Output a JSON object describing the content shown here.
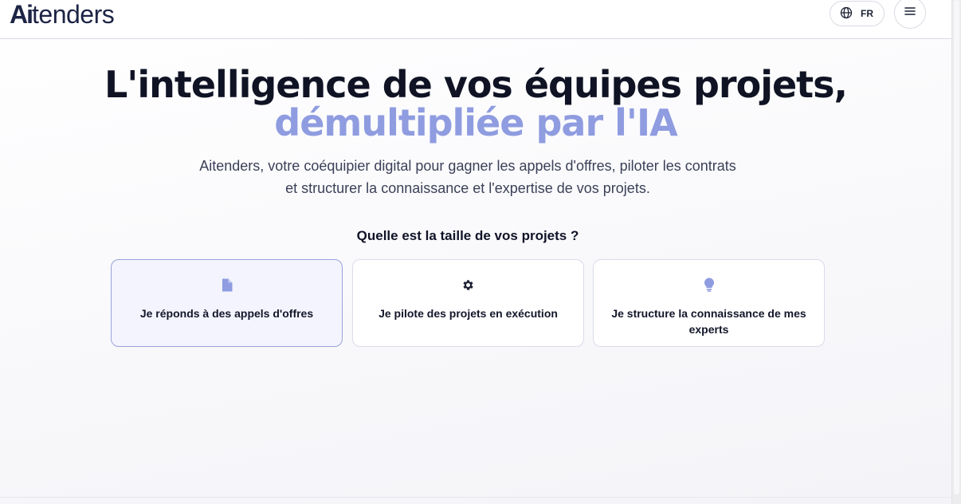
{
  "header": {
    "logo_ai": "Ai",
    "logo_rest": "tenders",
    "language": "FR",
    "icons": {
      "language": "globe-icon",
      "menu": "hamburger-menu-icon"
    }
  },
  "hero": {
    "title_line1": "L'intelligence de vos équipes projets,",
    "title_line2": "démultipliée par l'IA",
    "subtitle": "Aitenders, votre coéquipier digital pour gagner les appels d'offres, piloter les contrats et structurer la connaissance et l'expertise de vos projets."
  },
  "question": "Quelle est la taille de vos projets ?",
  "options": [
    {
      "label": "Je réponds à des appels d'offres",
      "icon": "document-icon",
      "selected": true
    },
    {
      "label": "Je pilote des projets en exécution",
      "icon": "gear-icon",
      "selected": false
    },
    {
      "label": "Je structure la connaissance de mes experts",
      "icon": "lightbulb-icon",
      "selected": false
    }
  ],
  "colors": {
    "accent": "#8f9ce0",
    "heading": "#0f1324",
    "selected_card_bg": "#f3f4fd"
  }
}
